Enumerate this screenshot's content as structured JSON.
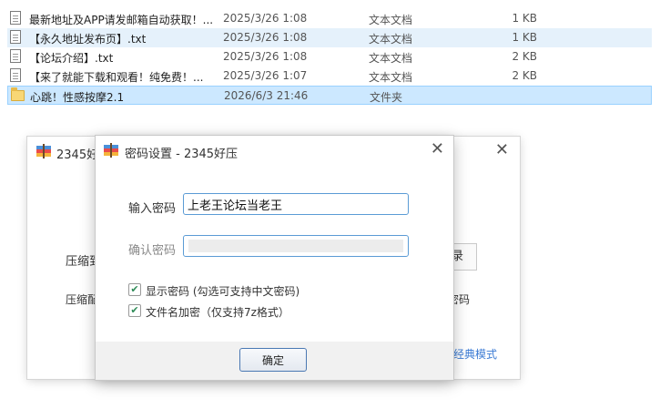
{
  "files": [
    {
      "name": "最新地址及APP请发邮箱自动获取！...",
      "date": "2025/3/26 1:08",
      "type": "文本文档",
      "size": "1 KB",
      "icon": "text-file-icon",
      "state": "normal"
    },
    {
      "name": "【永久地址发布页】.txt",
      "date": "2025/3/26 1:08",
      "type": "文本文档",
      "size": "1 KB",
      "icon": "text-file-icon",
      "state": "hover"
    },
    {
      "name": "【论坛介绍】.txt",
      "date": "2025/3/26 1:08",
      "type": "文本文档",
      "size": "2 KB",
      "icon": "text-file-icon",
      "state": "normal"
    },
    {
      "name": "【来了就能下载和观看！纯免费！...",
      "date": "2025/3/26 1:07",
      "type": "文本文档",
      "size": "2 KB",
      "icon": "text-file-icon",
      "state": "normal"
    },
    {
      "name": "心跳！性感按摩2.1",
      "date": "2026/6/3 21:46",
      "type": "文件夹",
      "size": "",
      "icon": "folder-icon",
      "state": "selected"
    }
  ],
  "bg_window": {
    "title": "2345好",
    "label_compress_to": "压缩到",
    "label_compress_method": "压缩配",
    "button_fragment": "录",
    "text_fragment": "密码",
    "classic_mode_link": "经典模式"
  },
  "dialog": {
    "title": "密码设置 - 2345好压",
    "password_label": "输入密码",
    "password_value": "上老王论坛当老王",
    "confirm_label": "确认密码",
    "show_password_label": "显示密码 (勾选可支持中文密码)",
    "show_password_checked": true,
    "encrypt_filename_label": "文件名加密（仅支持7z格式）",
    "encrypt_filename_checked": true,
    "ok_button": "确定",
    "close_symbol": "✕"
  },
  "colors": {
    "selection": "#cce8ff",
    "hover": "#e5f1fb",
    "input_focus": "#5b9bd5",
    "link": "#3b7bd4"
  }
}
